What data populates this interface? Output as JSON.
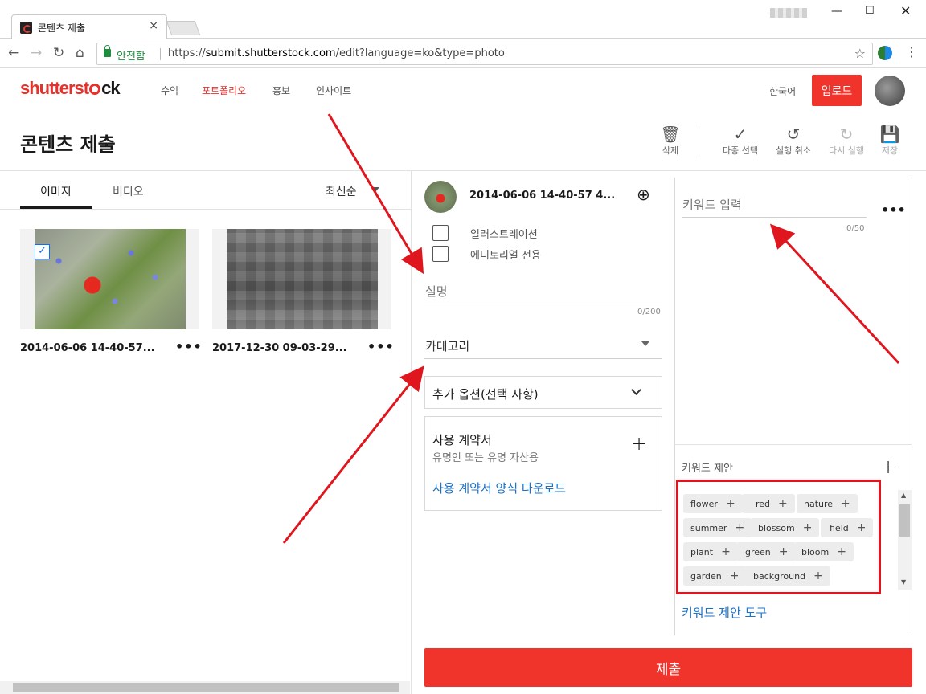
{
  "browser": {
    "tab_title": "콘텐츠 제출",
    "secure_label": "안전함",
    "url_scheme": "https://",
    "url_host": "submit.shutterstock.com",
    "url_path": "/edit?language=ko&type=photo"
  },
  "header": {
    "logo_red": "shutterst",
    "logo_dark": "ck",
    "nav": [
      "수익",
      "포트폴리오",
      "홍보",
      "인사이트"
    ],
    "active_nav_index": 1,
    "language": "한국어",
    "upload_label": "업로드"
  },
  "page": {
    "title": "콘텐츠 제출",
    "actions": {
      "delete": "삭제",
      "multi_select": "다중 선택",
      "undo": "실행 취소",
      "redo": "다시 실행",
      "save": "저장"
    }
  },
  "left": {
    "tabs": [
      "이미지",
      "비디오"
    ],
    "sort_label": "최신순",
    "items": [
      {
        "filename": "2014-06-06 14-40-57...",
        "selected": true
      },
      {
        "filename": "2017-12-30 09-03-29...",
        "selected": false
      }
    ]
  },
  "middle": {
    "title": "2014-06-06 14-40-57 4...",
    "illustration_label": "일러스트레이션",
    "editorial_label": "에디토리얼 전용",
    "description_placeholder": "설명",
    "description_counter": "0/200",
    "category_placeholder": "카테고리",
    "extra_options_label": "추가 옵션(선택 사항)",
    "release_title": "사용 계약서",
    "release_sub": "유명인 또는 유명 자산용",
    "release_link": "사용 계약서 양식 다운로드"
  },
  "right": {
    "keyword_placeholder": "키워드 입력",
    "keyword_counter": "0/50",
    "suggestions_title": "키워드 제안",
    "suggestions": [
      "flower",
      "red",
      "nature",
      "summer",
      "blossom",
      "field",
      "plant",
      "green",
      "bloom",
      "garden",
      "background"
    ],
    "tool_link": "키워드 제안 도구"
  },
  "submit_label": "제출",
  "colors": {
    "brand_red": "#f0342c",
    "link_blue": "#1b73c8",
    "annotation_red": "#e0161e"
  }
}
